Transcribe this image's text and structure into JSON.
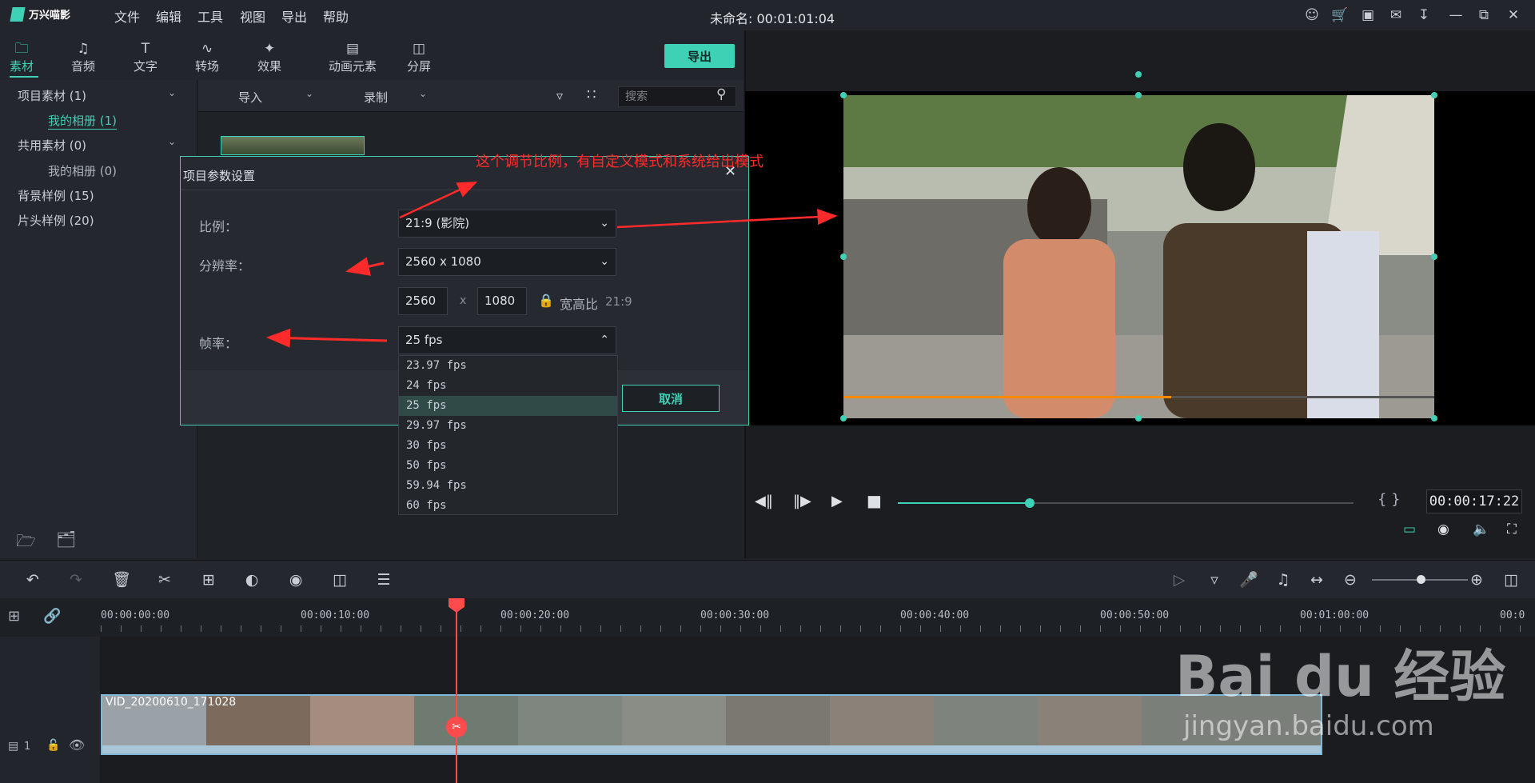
{
  "app": {
    "name": "万兴喵影",
    "window_title": "未命名: 00:01:01:04"
  },
  "menu": [
    "文件",
    "编辑",
    "工具",
    "视图",
    "导出",
    "帮助"
  ],
  "tabs": [
    {
      "label": "素材",
      "icon": "folder-icon",
      "active": true
    },
    {
      "label": "音频",
      "icon": "music-note-icon"
    },
    {
      "label": "文字",
      "icon": "text-icon"
    },
    {
      "label": "转场",
      "icon": "transition-icon"
    },
    {
      "label": "效果",
      "icon": "effects-icon"
    },
    {
      "label": "动画元素",
      "icon": "image-icon"
    },
    {
      "label": "分屏",
      "icon": "split-screen-icon"
    }
  ],
  "export_label": "导出",
  "sidebar": [
    {
      "label": "项目素材 (1)",
      "level": 0
    },
    {
      "label": "我的相册 (1)",
      "level": 1,
      "highlight": true
    },
    {
      "label": "共用素材 (0)",
      "level": 0
    },
    {
      "label": "我的相册 (0)",
      "level": 1
    },
    {
      "label": "背景样例 (15)",
      "level": 0
    },
    {
      "label": "片头样例 (20)",
      "level": 0
    }
  ],
  "media_toolbar": {
    "import_label": "导入",
    "record_label": "录制",
    "search_placeholder": "搜索"
  },
  "dialog": {
    "title": "项目参数设置",
    "ratio_label": "比例：",
    "ratio_value": "21:9 (影院)",
    "resolution_label": "分辨率：",
    "resolution_value": "2560 x 1080",
    "width": "2560",
    "x_sep": "x",
    "height": "1080",
    "aspect_label": "宽高比",
    "aspect_value": "21:9",
    "fps_label": "帧率：",
    "fps_value": "25 fps",
    "fps_options": [
      "23.97 fps",
      "24 fps",
      "25 fps",
      "29.97 fps",
      "30 fps",
      "50 fps",
      "59.94 fps",
      "60 fps"
    ],
    "fps_selected_index": 2,
    "cancel_label": "取消"
  },
  "annotation": "这个调节比例，有自定义模式和系统给出模式",
  "preview": {
    "timecode": "00:00:17:22",
    "progress": 0.29,
    "braces": "{  }"
  },
  "timeline": {
    "ruler": [
      "00:00:00:00",
      "00:00:10:00",
      "00:00:20:00",
      "00:00:30:00",
      "00:00:40:00",
      "00:00:50:00",
      "00:01:00:00",
      "00:0"
    ],
    "clip_name": "VID_20200610_171028",
    "track_label": "1"
  },
  "watermark": {
    "line1": "Bai du 经验",
    "line2": "jingyan.baidu.com"
  }
}
